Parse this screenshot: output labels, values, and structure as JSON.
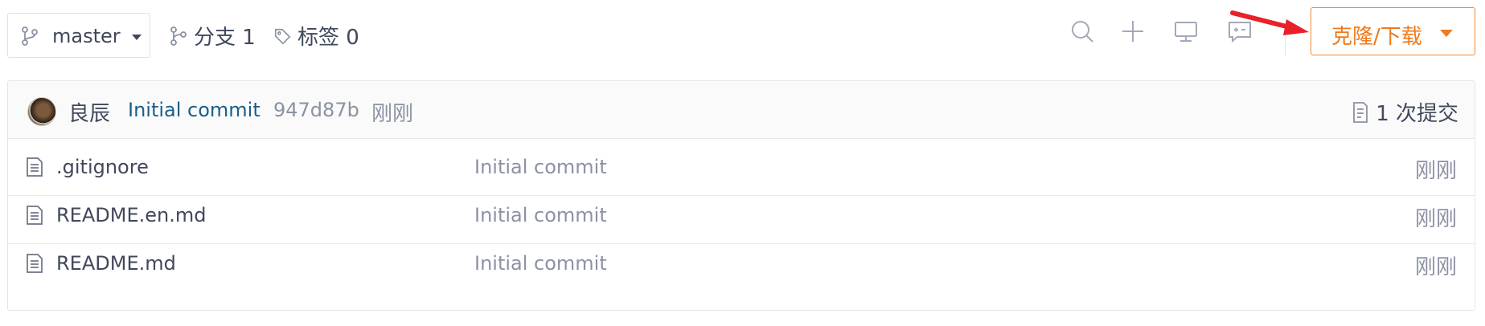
{
  "toolbar": {
    "branch": {
      "label": "master",
      "icon": "git-branch-icon"
    },
    "branches": {
      "label": "分支 1",
      "icon": "branch-icon"
    },
    "tags": {
      "label": "标签 0",
      "icon": "tag-icon"
    },
    "icons": [
      "search-icon",
      "plus-icon",
      "monitor-icon",
      "code-review-icon"
    ],
    "clone_button": {
      "label": "克隆/下载",
      "color": "#f07a1c"
    }
  },
  "last_commit": {
    "author": "良辰",
    "message": "Initial commit",
    "sha": "947d87b",
    "time": "刚刚",
    "count_label": "1 次提交"
  },
  "files": [
    {
      "name": ".gitignore",
      "message": "Initial commit",
      "time": "刚刚",
      "icon": "file-text-icon"
    },
    {
      "name": "README.en.md",
      "message": "Initial commit",
      "time": "刚刚",
      "icon": "file-text-icon"
    },
    {
      "name": "README.md",
      "message": "Initial commit",
      "time": "刚刚",
      "icon": "file-text-icon"
    }
  ],
  "annotation": {
    "arrow_color": "#e8202a"
  }
}
